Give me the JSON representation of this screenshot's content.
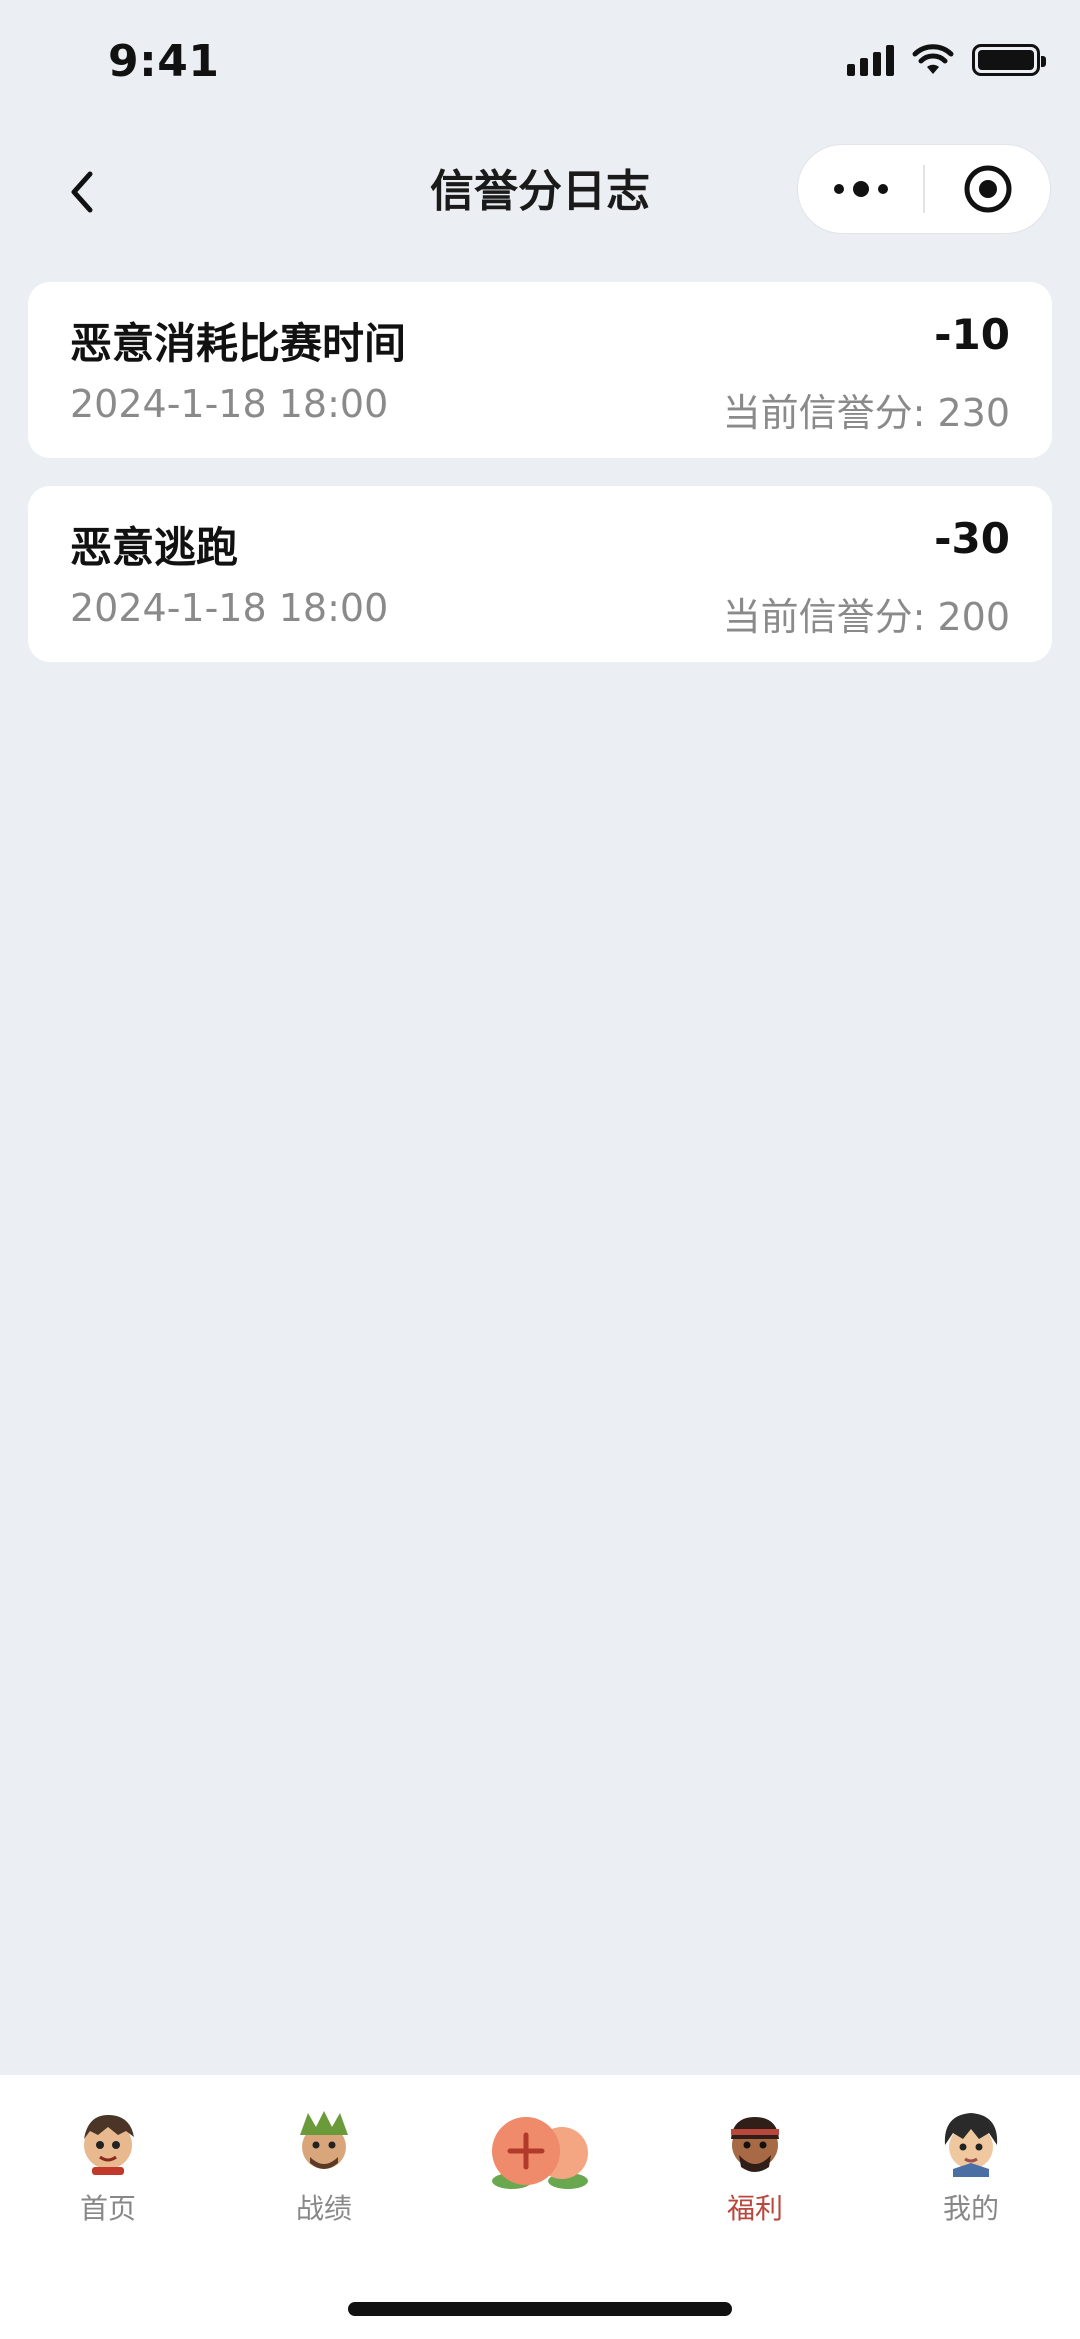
{
  "status_bar": {
    "time": "9:41"
  },
  "nav": {
    "title": "信誉分日志"
  },
  "records": [
    {
      "reason": "恶意消耗比赛时间",
      "delta": "-10",
      "time": "2024-1-18 18:00",
      "score_label": "当前信誉分:",
      "score_value": "230"
    },
    {
      "reason": "恶意逃跑",
      "delta": "-30",
      "time": "2024-1-18 18:00",
      "score_label": "当前信誉分:",
      "score_value": "200"
    }
  ],
  "tabbar": {
    "items": [
      {
        "label": "首页",
        "icon": "home-avatar-icon"
      },
      {
        "label": "战绩",
        "icon": "record-avatar-icon"
      },
      {
        "label": "",
        "icon": "peach-plus-icon"
      },
      {
        "label": "福利",
        "icon": "welfare-avatar-icon",
        "active": true
      },
      {
        "label": "我的",
        "icon": "mine-avatar-icon"
      }
    ]
  },
  "colors": {
    "background": "#ebeff3",
    "card": "#ffffff",
    "active_tab": "#b9473c",
    "muted_text": "#8a8a8a"
  }
}
